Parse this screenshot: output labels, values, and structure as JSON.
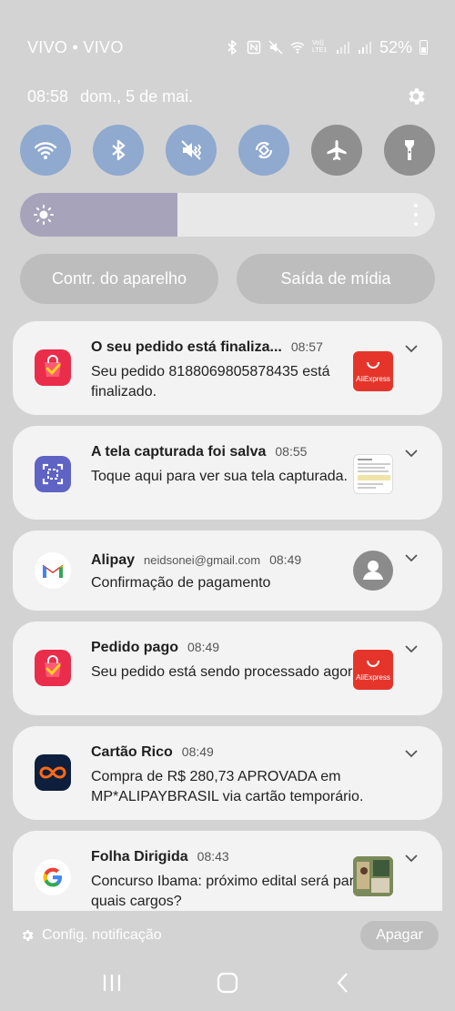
{
  "status_bar": {
    "carrier": "VIVO • VIVO",
    "network_label": "Vo)) LTE1",
    "battery": "52%"
  },
  "header": {
    "time": "08:58",
    "date": "dom., 5 de mai."
  },
  "quick_toggles": [
    {
      "name": "wifi",
      "on": true
    },
    {
      "name": "bluetooth",
      "on": true
    },
    {
      "name": "mute",
      "on": true
    },
    {
      "name": "auto-rotate",
      "on": true
    },
    {
      "name": "airplane-mode",
      "on": false
    },
    {
      "name": "flashlight",
      "on": false
    }
  ],
  "brightness": {
    "level_percent": 38
  },
  "buttons": {
    "device_control": "Contr. do aparelho",
    "media_output": "Saída de mídia"
  },
  "notifications": [
    {
      "app": "aliexpress",
      "title": "O seu pedido está finaliza...",
      "time": "08:57",
      "body": "Seu pedido 8188069805878435 está finalizado.",
      "thumb_label": "AliExpress"
    },
    {
      "app": "screenshot",
      "title": "A tela capturada foi salva",
      "time": "08:55",
      "body": "Toque aqui para ver sua tela capturada."
    },
    {
      "app": "gmail",
      "title": "Alipay",
      "subtitle": "neidsonei@gmail.com",
      "time": "08:49",
      "body": "Confirmação de pagamento"
    },
    {
      "app": "aliexpress",
      "title": "Pedido pago",
      "time": "08:49",
      "body": "Seu pedido está sendo processado agora",
      "thumb_label": "AliExpress"
    },
    {
      "app": "cartao-rico",
      "title": "Cartão Rico",
      "time": "08:49",
      "body": "Compra de R$ 280,73 APROVADA em MP*ALIPAYBRASIL via cartão temporário."
    },
    {
      "app": "google",
      "title": "Folha Dirigida",
      "time": "08:43",
      "body": "Concurso Ibama: próximo edital será para quais cargos?"
    }
  ],
  "footer": {
    "settings": "Config. notificação",
    "clear": "Apagar"
  },
  "colors": {
    "background": "#d3d3d3",
    "toggle_on": "#8fa9cf",
    "toggle_off": "#8f8f8f",
    "card": "#f3f3f3",
    "aliexpress_red": "#e5352b",
    "screenshot_purple": "#5f63c4"
  }
}
